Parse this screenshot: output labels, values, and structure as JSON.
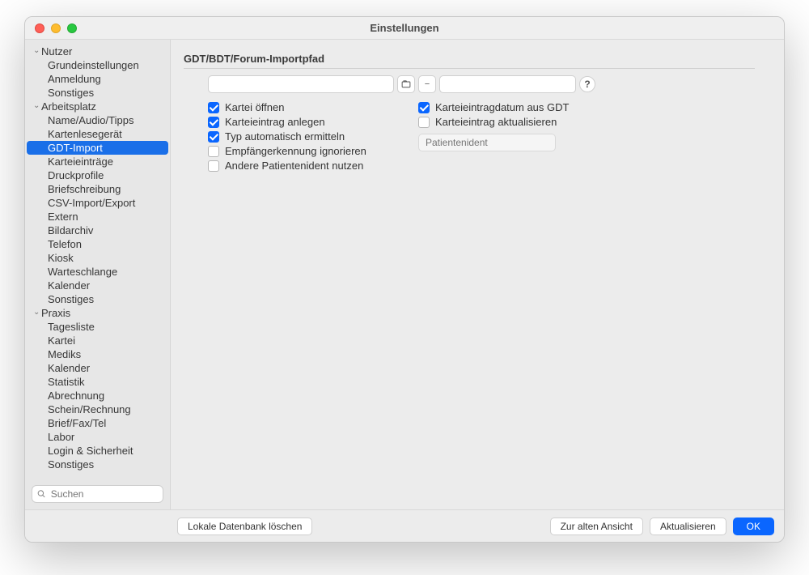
{
  "window": {
    "title": "Einstellungen"
  },
  "sidebar": {
    "search_placeholder": "Suchen",
    "groups": [
      {
        "label": "Nutzer",
        "items": [
          "Grundeinstellungen",
          "Anmeldung",
          "Sonstiges"
        ]
      },
      {
        "label": "Arbeitsplatz",
        "items": [
          "Name/Audio/Tipps",
          "Kartenlesegerät",
          "GDT-Import",
          "Karteieinträge",
          "Druckprofile",
          "Briefschreibung",
          "CSV-Import/Export",
          "Extern",
          "Bildarchiv",
          "Telefon",
          "Kiosk",
          "Warteschlange",
          "Kalender",
          "Sonstiges"
        ]
      },
      {
        "label": "Praxis",
        "items": [
          "Tagesliste",
          "Kartei",
          "Mediks",
          "Kalender",
          "Statistik",
          "Abrechnung",
          "Schein/Rechnung",
          "Brief/Fax/Tel",
          "Labor",
          "Login & Sicherheit",
          "Sonstiges"
        ]
      }
    ],
    "selected": "GDT-Import"
  },
  "main": {
    "section_title": "GDT/BDT/Forum-Importpfad",
    "path_value": "",
    "second_value": "",
    "help_label": "?",
    "remove_label": "−",
    "options_left": [
      {
        "label": "Kartei öffnen",
        "checked": true
      },
      {
        "label": "Karteieintrag anlegen",
        "checked": true
      },
      {
        "label": "Typ automatisch ermitteln",
        "checked": true
      },
      {
        "label": "Empfängerkennung ignorieren",
        "checked": false
      },
      {
        "label": "Andere Patientenident nutzen",
        "checked": false
      }
    ],
    "options_right": [
      {
        "label": "Karteieintragdatum aus GDT",
        "checked": true
      },
      {
        "label": "Karteieintrag aktualisieren",
        "checked": false
      }
    ],
    "patient_placeholder": "Patientenident"
  },
  "footer": {
    "delete_db": "Lokale Datenbank löschen",
    "old_view": "Zur alten Ansicht",
    "refresh": "Aktualisieren",
    "ok": "OK"
  }
}
